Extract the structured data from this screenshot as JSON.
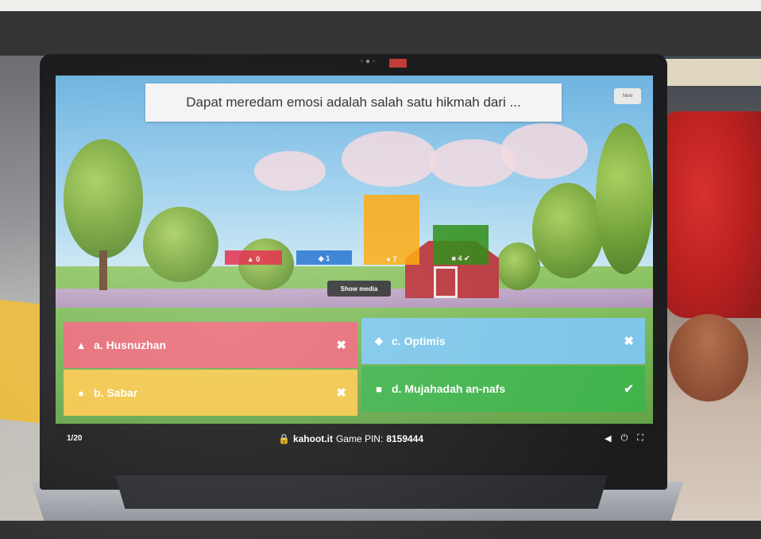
{
  "question": {
    "text": "Dapat meredam emosi adalah salah satu hikmah dari ...",
    "next_label": "Next"
  },
  "results": [
    {
      "shape": "triangle-icon",
      "glyph": "▲",
      "count": "0",
      "level": 0.0,
      "color": "#e21b3c"
    },
    {
      "shape": "diamond-icon",
      "glyph": "◆",
      "count": "1",
      "level": 0.05,
      "color": "#1368ce"
    },
    {
      "shape": "circle-icon",
      "glyph": "●",
      "count": "7",
      "level": 0.35,
      "color": "#ffa602"
    },
    {
      "shape": "square-icon",
      "glyph": "■",
      "count": "4",
      "level": 0.2,
      "color": "#26890c",
      "correct": true
    }
  ],
  "show_media_label": "Show media",
  "answers": [
    {
      "shape": "triangle-icon",
      "glyph": "▲",
      "label": "a. Husnuzhan",
      "mark": "✖",
      "color": "#e66a74"
    },
    {
      "shape": "diamond-icon",
      "glyph": "◆",
      "label": "c. Optimis",
      "mark": "✖",
      "color": "#7cc6ea"
    },
    {
      "shape": "circle-icon",
      "glyph": "●",
      "label": "b. Sabar",
      "mark": "✖",
      "color": "#f2c64a"
    },
    {
      "shape": "square-icon",
      "glyph": "■",
      "label": "d. Mujahadah an-nafs",
      "mark": "✔",
      "color": "#3fb34a"
    }
  ],
  "footer": {
    "counter": "1/20",
    "site": "kahoot.it",
    "pin_label": "Game PIN:",
    "pin": "8159444"
  },
  "controls": {
    "volume_icon": "◀",
    "power_icon": "⏻",
    "fullscreen_icon": "⛶"
  }
}
